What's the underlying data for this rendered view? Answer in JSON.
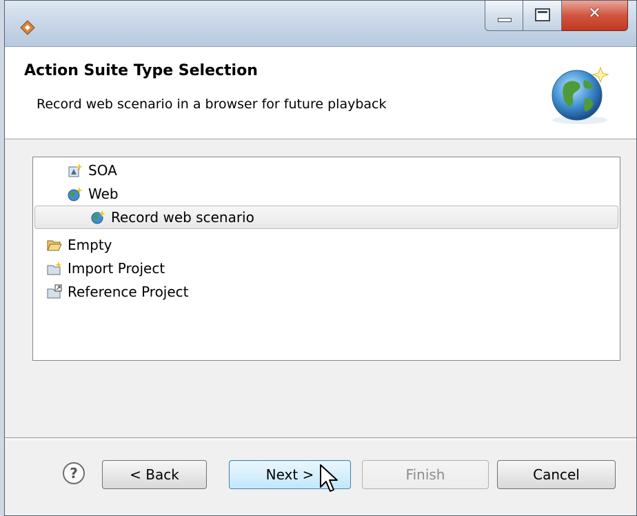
{
  "window": {
    "title": ""
  },
  "header": {
    "title": "Action Suite Type Selection",
    "description": "Record web scenario in a browser for future playback"
  },
  "tree": {
    "items": [
      {
        "label": "SOA",
        "icon": "soa-wizard-icon"
      },
      {
        "label": "Web",
        "icon": "web-wizard-icon"
      },
      {
        "label": "Record web scenario",
        "icon": "record-web-icon",
        "selected": true
      },
      {
        "label": "Empty",
        "icon": "open-folder-icon"
      },
      {
        "label": "Import Project",
        "icon": "import-project-icon"
      },
      {
        "label": "Reference Project",
        "icon": "reference-project-icon"
      }
    ]
  },
  "buttons": {
    "back": "< Back",
    "next": "Next >",
    "finish": "Finish",
    "cancel": "Cancel",
    "help": "?"
  },
  "colors": {
    "selection_border": "#b9b9b9",
    "next_border": "#3c7fb1",
    "close_button": "#c13a21"
  }
}
